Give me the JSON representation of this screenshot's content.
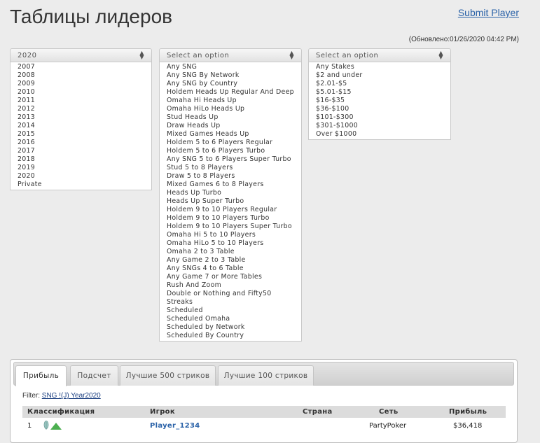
{
  "header": {
    "title": "Таблицы лидеров",
    "submit_label": "Submit Player",
    "updated": "(Обновлено:01/26/2020 04:42 PM)"
  },
  "year_select": {
    "value": "2020",
    "options": [
      "2007",
      "2008",
      "2009",
      "2010",
      "2011",
      "2012",
      "2013",
      "2014",
      "2015",
      "2016",
      "2017",
      "2018",
      "2019",
      "2020",
      "Private"
    ]
  },
  "game_select": {
    "value": "Select an option",
    "options": [
      "Any SNG",
      "Any SNG By Network",
      "Any SNG by Country",
      "Holdem Heads Up Regular And Deep",
      "Omaha Hi Heads Up",
      "Omaha HiLo Heads Up",
      "Stud Heads Up",
      "Draw Heads Up",
      "Mixed Games Heads Up",
      "Holdem 5 to 6 Players Regular",
      "Holdem 5 to 6 Players Turbo",
      "Any SNG 5 to 6 Players Super Turbo",
      "Stud 5 to 8 Players",
      "Draw 5 to 8 Players",
      "Mixed Games 6 to 8 Players",
      "Heads Up Turbo",
      "Heads Up Super Turbo",
      "Holdem 9 to 10 Players Regular",
      "Holdem 9 to 10 Players Turbo",
      "Holdem 9 to 10 Players Super Turbo",
      "Omaha Hi 5 to 10 Players",
      "Omaha HiLo 5 to 10 Players",
      "Omaha 2 to 3 Table",
      "Any Game 2 to 3 Table",
      "Any SNGs 4 to 6 Table",
      "Any Game 7 or More Tables",
      "Rush And Zoom",
      "Double or Nothing and Fifty50",
      "Streaks",
      "Scheduled",
      "Scheduled Omaha",
      "Scheduled by Network",
      "Scheduled By Country"
    ]
  },
  "stakes_select": {
    "value": "Select an option",
    "options": [
      "Any Stakes",
      "$2 and under",
      "$2.01-$5",
      "$5.01-$15",
      "$16-$35",
      "$36-$100",
      "$101-$300",
      "$301-$1000",
      "Over $1000"
    ]
  },
  "tabs": [
    {
      "label": "Прибыль",
      "active": true
    },
    {
      "label": "Подсчет",
      "active": false
    },
    {
      "label": "Лучшие 500 стриков",
      "active": false
    },
    {
      "label": "Лучшие 100 стриков",
      "active": false
    }
  ],
  "filter": {
    "prefix": "Filter:",
    "link": "SNG !(J) Year2020"
  },
  "table": {
    "columns": [
      "Классификация",
      "Игрок",
      "Страна",
      "Сеть",
      "Прибыль"
    ],
    "rows": [
      {
        "rank": "1",
        "player": "Player_1234",
        "country": "",
        "network": "PartyPoker",
        "profit": "$36,418"
      }
    ]
  },
  "colors": {
    "link": "#2a62a8",
    "background": "#ececec",
    "trend_up": "#4caf50"
  },
  "icons": [
    "chevron-up-down-icon",
    "trend-up-icon",
    "leaf-icon"
  ]
}
